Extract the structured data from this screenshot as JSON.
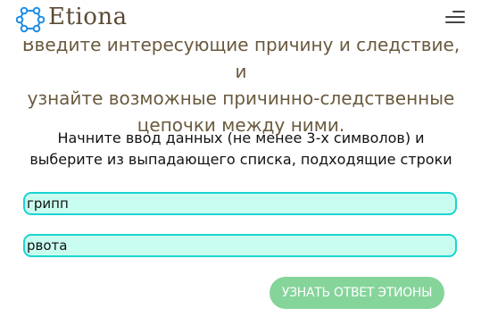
{
  "header": {
    "brand": "Etiona",
    "logo_icon": "molecule-logo-icon",
    "menu_icon": "hamburger-menu-icon"
  },
  "intro": {
    "line1": "Введите интересующие причину и следствие, и",
    "line2": "узнайте возможные причинно-следственные",
    "line3": "цепочки между ними."
  },
  "instructions": {
    "line1": "Начните ввод данных (не менее 3-х символов) и",
    "line2": "выберите из выпадающего списка, подходящие строки"
  },
  "form": {
    "cause_value": "грипп",
    "effect_value": "рвота",
    "submit_label": "УЗНАТЬ ОТВЕТ ЭТИОНЫ"
  },
  "colors": {
    "input_border": "#1bd4d1",
    "input_background": "#c9fdf0",
    "button": "#85d49a",
    "logo": "#1e8ee6",
    "intro_text": "#6a5a3e"
  }
}
